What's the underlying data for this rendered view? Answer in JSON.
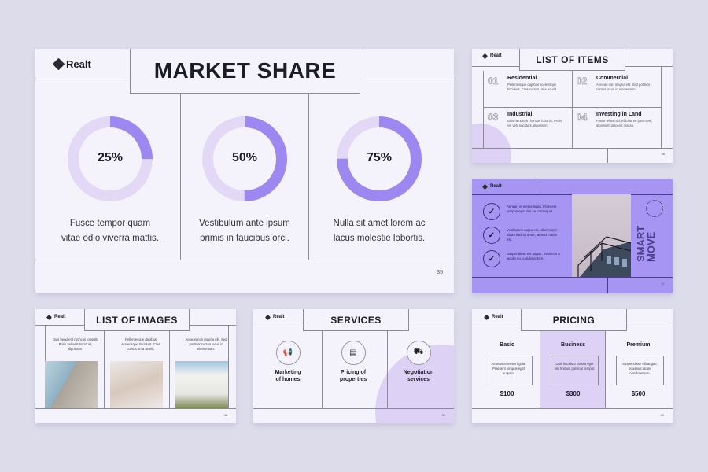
{
  "brand": "Realt",
  "colors": {
    "accent": "#9d87f0",
    "accent_light": "#e3d9f7",
    "purple_slide": "#a795f4",
    "background": "#dddceb"
  },
  "market_share": {
    "title": "MARKET SHARE",
    "page": "35",
    "items": [
      {
        "percent": 25,
        "label": "25%",
        "text1": "Fusce tempor quam",
        "text2": "vitae odio viverra mattis."
      },
      {
        "percent": 50,
        "label": "50%",
        "text1": "Vestibulum ante ipsum",
        "text2": "primis in faucibus orci."
      },
      {
        "percent": 75,
        "label": "75%",
        "text1": "Nulla sit amet lorem ac",
        "text2": "lacus molestie lobortis."
      }
    ]
  },
  "list_of_items": {
    "title": "LIST OF ITEMS",
    "page": "36",
    "items": [
      {
        "num": "01",
        "title": "Residential",
        "text": "Pellentesque dapibus scelerisque tincidunt. Cras cursus urna ac elit."
      },
      {
        "num": "02",
        "title": "Commercial",
        "text": "Aenean non magna elit. Sed porttitor cursus lacus in elementum."
      },
      {
        "num": "03",
        "title": "Industrial",
        "text": "Duis hendrerit rhoncus lobortis. Proin vel velit tincidunt, dignissim."
      },
      {
        "num": "04",
        "title": "Investing in Land",
        "text": "Fusce tellus nisi, efficitur eu ipsum vel, dignissim placerat massa."
      }
    ]
  },
  "smart_move": {
    "vertical_text": "SMART MOVE",
    "page": "37",
    "checks": [
      {
        "text": "Aenean et metus ligula. Praesent tempus eget nisi eu consequat.",
        "icon": "check-icon"
      },
      {
        "text": "Vestibulum augue mi, ullamcorper vitae risus sit amet, laoreet mattis est.",
        "icon": "check-icon"
      },
      {
        "text": "Suspendisse elit augue, maximus a iaculis eu, condimentum.",
        "icon": "check-icon"
      }
    ]
  },
  "list_of_images": {
    "title": "LIST OF IMAGES",
    "page": "38",
    "items": [
      {
        "text": "Duis hendrerit rhoncus lobortis. Proin vel velit tincidunt, dignissim."
      },
      {
        "text": "Pellentesque dapibus scelerisque tincidunt. Cras cursus urna ac elit."
      },
      {
        "text": "Aenean non magna elit. Sed porttitor cursus lacus in elementum."
      }
    ]
  },
  "services": {
    "title": "SERVICES",
    "page": "39",
    "items": [
      {
        "icon": "megaphone-icon",
        "line1": "Marketing",
        "line2": "of homes"
      },
      {
        "icon": "wallet-icon",
        "line1": "Pricing of",
        "line2": "properties"
      },
      {
        "icon": "handshake-icon",
        "line1": "Negotiation",
        "line2": "services"
      }
    ]
  },
  "pricing": {
    "title": "PRICING",
    "page": "40",
    "plans": [
      {
        "name": "Basic",
        "text": "Aenean et metus ligula. Praesent tempus eget augufin.",
        "price": "$100"
      },
      {
        "name": "Business",
        "text": "Duis tincidunt massa eget nisi finibus, pulvinar tempor.",
        "price": "$300",
        "highlight": true
      },
      {
        "name": "Premium",
        "text": "Suspendisse elit augue, maximus iaculis condimentum.",
        "price": "$500"
      }
    ]
  }
}
